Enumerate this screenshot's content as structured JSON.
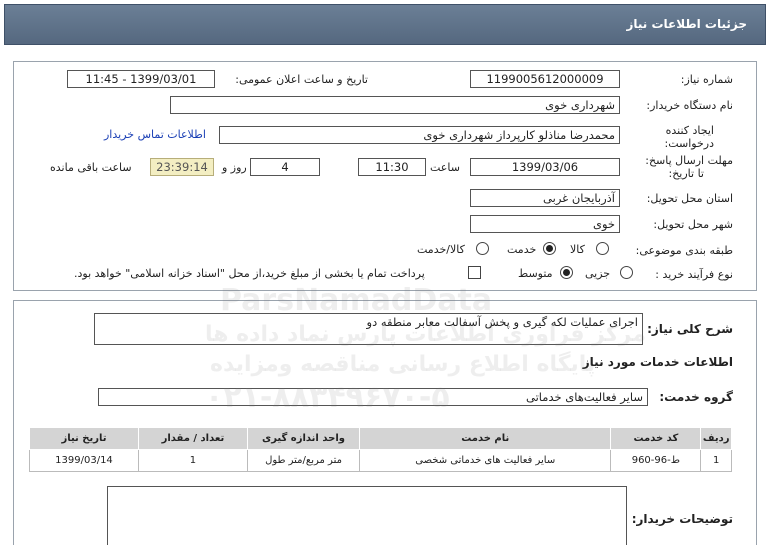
{
  "header": {
    "title": "جزئیات اطلاعات نیاز"
  },
  "need_info": {
    "need_number_label": "شماره نیاز:",
    "need_number": "1199005612000009",
    "announce_label": "تاریخ و ساعت اعلان عمومی:",
    "announce_value": "1399/03/01 - 11:45",
    "buyer_org_label": "نام دستگاه خریدار:",
    "buyer_org": "شهرداری خوی",
    "creator_label_1": "ایجاد کننده",
    "creator_label_2": "درخواست:",
    "creator": "محمدرضا مناذلو کارپرداز شهرداری خوی",
    "contact_link": "اطلاعات تماس خریدار",
    "deadline_label_1": "مهلت ارسال پاسخ:",
    "deadline_label_2": "تا تاریخ:",
    "deadline_date": "1399/03/06",
    "time_label": "ساعت",
    "deadline_time": "11:30",
    "days_value": "4",
    "days_label": "روز و",
    "remaining_time": "23:39:14",
    "remaining_label": "ساعت باقی مانده",
    "province_label": "استان محل تحویل:",
    "province": "آذربایجان غربی",
    "city_label": "شهر محل تحویل:",
    "city": "خوی",
    "category_label": "طبقه بندی موضوعی:",
    "category_options": [
      "کالا",
      "خدمت",
      "کالا/خدمت"
    ],
    "category_selected": "خدمت",
    "process_label": "نوع فرآیند خرید :",
    "process_options": [
      "جزیی",
      "متوسط"
    ],
    "process_selected": "متوسط",
    "payment_note": "پرداخت تمام یا بخشی از مبلغ خرید،از محل \"اسناد خزانه اسلامی\" خواهد بود."
  },
  "description": {
    "label": "شرح کلی نیاز:",
    "value": "اجرای عملیات لکه گیری و پخش آسفالت معابر منطقه دو"
  },
  "services": {
    "section_title": "اطلاعات خدمات مورد نیاز",
    "group_label": "گروه خدمت:",
    "group_value": "سایر فعالیت‌های خدماتی",
    "columns": [
      "ردیف",
      "کد خدمت",
      "نام خدمت",
      "واحد اندازه گیری",
      "تعداد / مقدار",
      "تاریخ نیاز"
    ],
    "rows": [
      [
        "1",
        "ط-96-960",
        "سایر فعالیت های خدماتی شخصی",
        "متر مربع/متر طول",
        "1",
        "1399/03/14"
      ]
    ]
  },
  "buyer_notes": {
    "label": "توضیحات خریدار:"
  },
  "watermark": {
    "line1": "ParsNamadData",
    "line2": "مرکز فراوری اطلاعات پارس نماد داده ها",
    "line3": "پایگاه اطلاع رسانی مناقصه ومزایده",
    "line4": "۰۲۱-۸۸۳۴۹۶۷۰-۵"
  }
}
